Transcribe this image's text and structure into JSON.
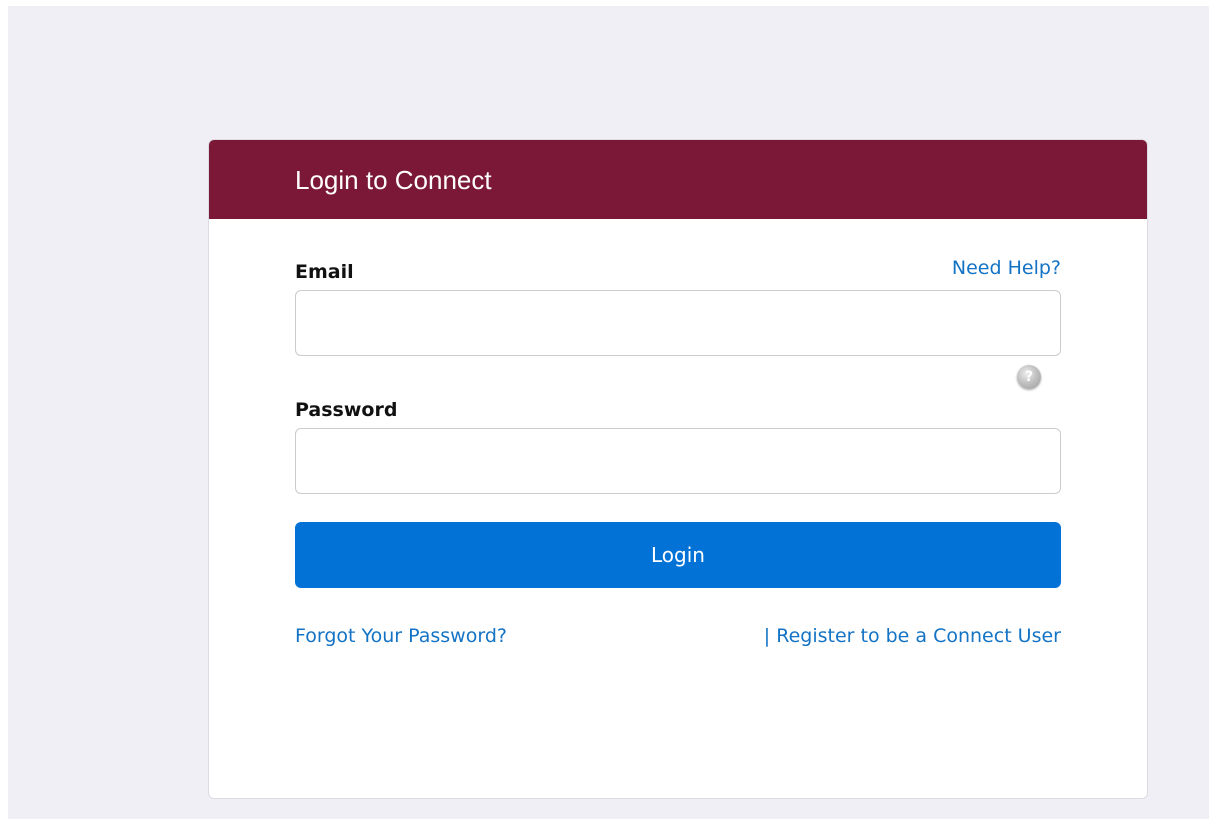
{
  "colors": {
    "header_bg": "#7b1838",
    "link": "#1473c4",
    "button_bg": "#0272d6",
    "page_bg": "#f0eff5"
  },
  "login_card": {
    "title": "Login to Connect",
    "help_link": "Need Help?",
    "email": {
      "label": "Email",
      "value": "",
      "placeholder": ""
    },
    "help_icon": "question-mark-icon",
    "password": {
      "label": "Password",
      "value": "",
      "placeholder": ""
    },
    "login_button": "Login",
    "forgot_password": "Forgot Your Password?",
    "separator": "|",
    "register_link": "Register to be a Connect User"
  }
}
